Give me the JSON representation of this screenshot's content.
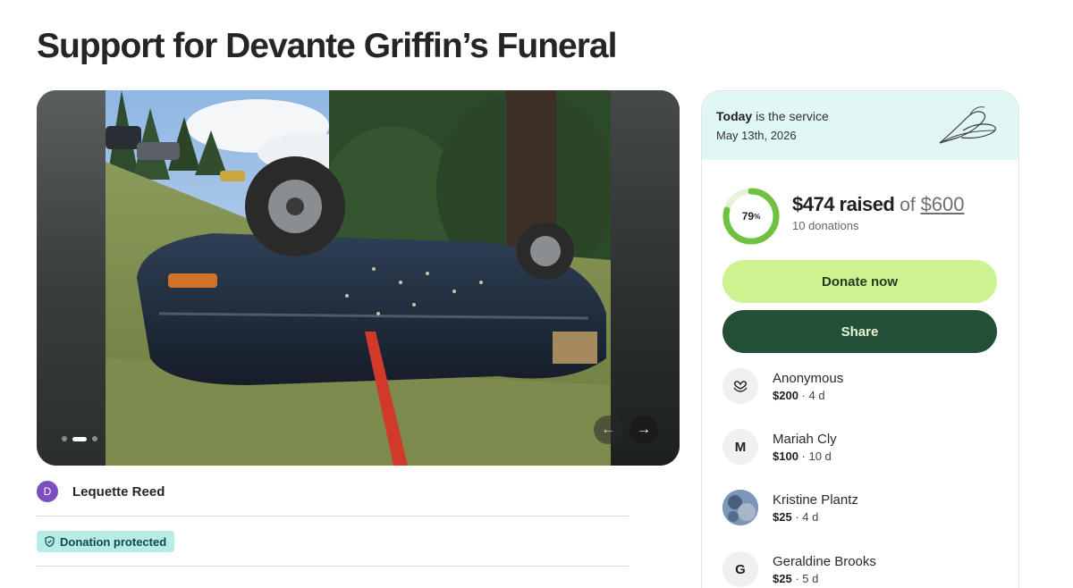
{
  "page": {
    "title": "Support for Devante Griffin’s Funeral"
  },
  "gallery": {
    "prev_icon": "←",
    "next_icon": "→",
    "slides": 3,
    "active_slide": 2
  },
  "organizer": {
    "initial": "D",
    "name": "Lequette Reed",
    "avatar_color": "#7b4fbf"
  },
  "badge": {
    "label": "Donation protected",
    "icon": "shield-icon"
  },
  "card": {
    "header": {
      "today": "Today",
      "service_text": " is the service",
      "date": "May 13th, 2026",
      "icon": "leaf-icon"
    },
    "progress": {
      "percent": 79,
      "percent_label": "79",
      "percent_sign": "%",
      "raised": "$474 raised",
      "of": " of ",
      "goal": "$600",
      "donations": "10 donations"
    },
    "buttons": {
      "donate": "Donate now",
      "share": "Share"
    },
    "donors": [
      {
        "name": "Anonymous",
        "amount": "$200",
        "time": " · 4 d",
        "avatar": "heart-hands-icon"
      },
      {
        "name": "Mariah Cly",
        "amount": "$100",
        "time": " · 10 d",
        "avatar_initial": "M"
      },
      {
        "name": "Kristine Plantz",
        "amount": "$25",
        "time": " · 4 d",
        "avatar": "photo-avatar"
      },
      {
        "name": "Geraldine Brooks",
        "amount": "$25",
        "time": " · 5 d",
        "avatar_initial": "G"
      }
    ]
  },
  "colors": {
    "accent_green": "#cdf28f",
    "dark_green": "#224f36",
    "progress_green": "#6fc13f",
    "header_bg": "#e1f7f5",
    "badge_bg": "#b7ece6"
  }
}
